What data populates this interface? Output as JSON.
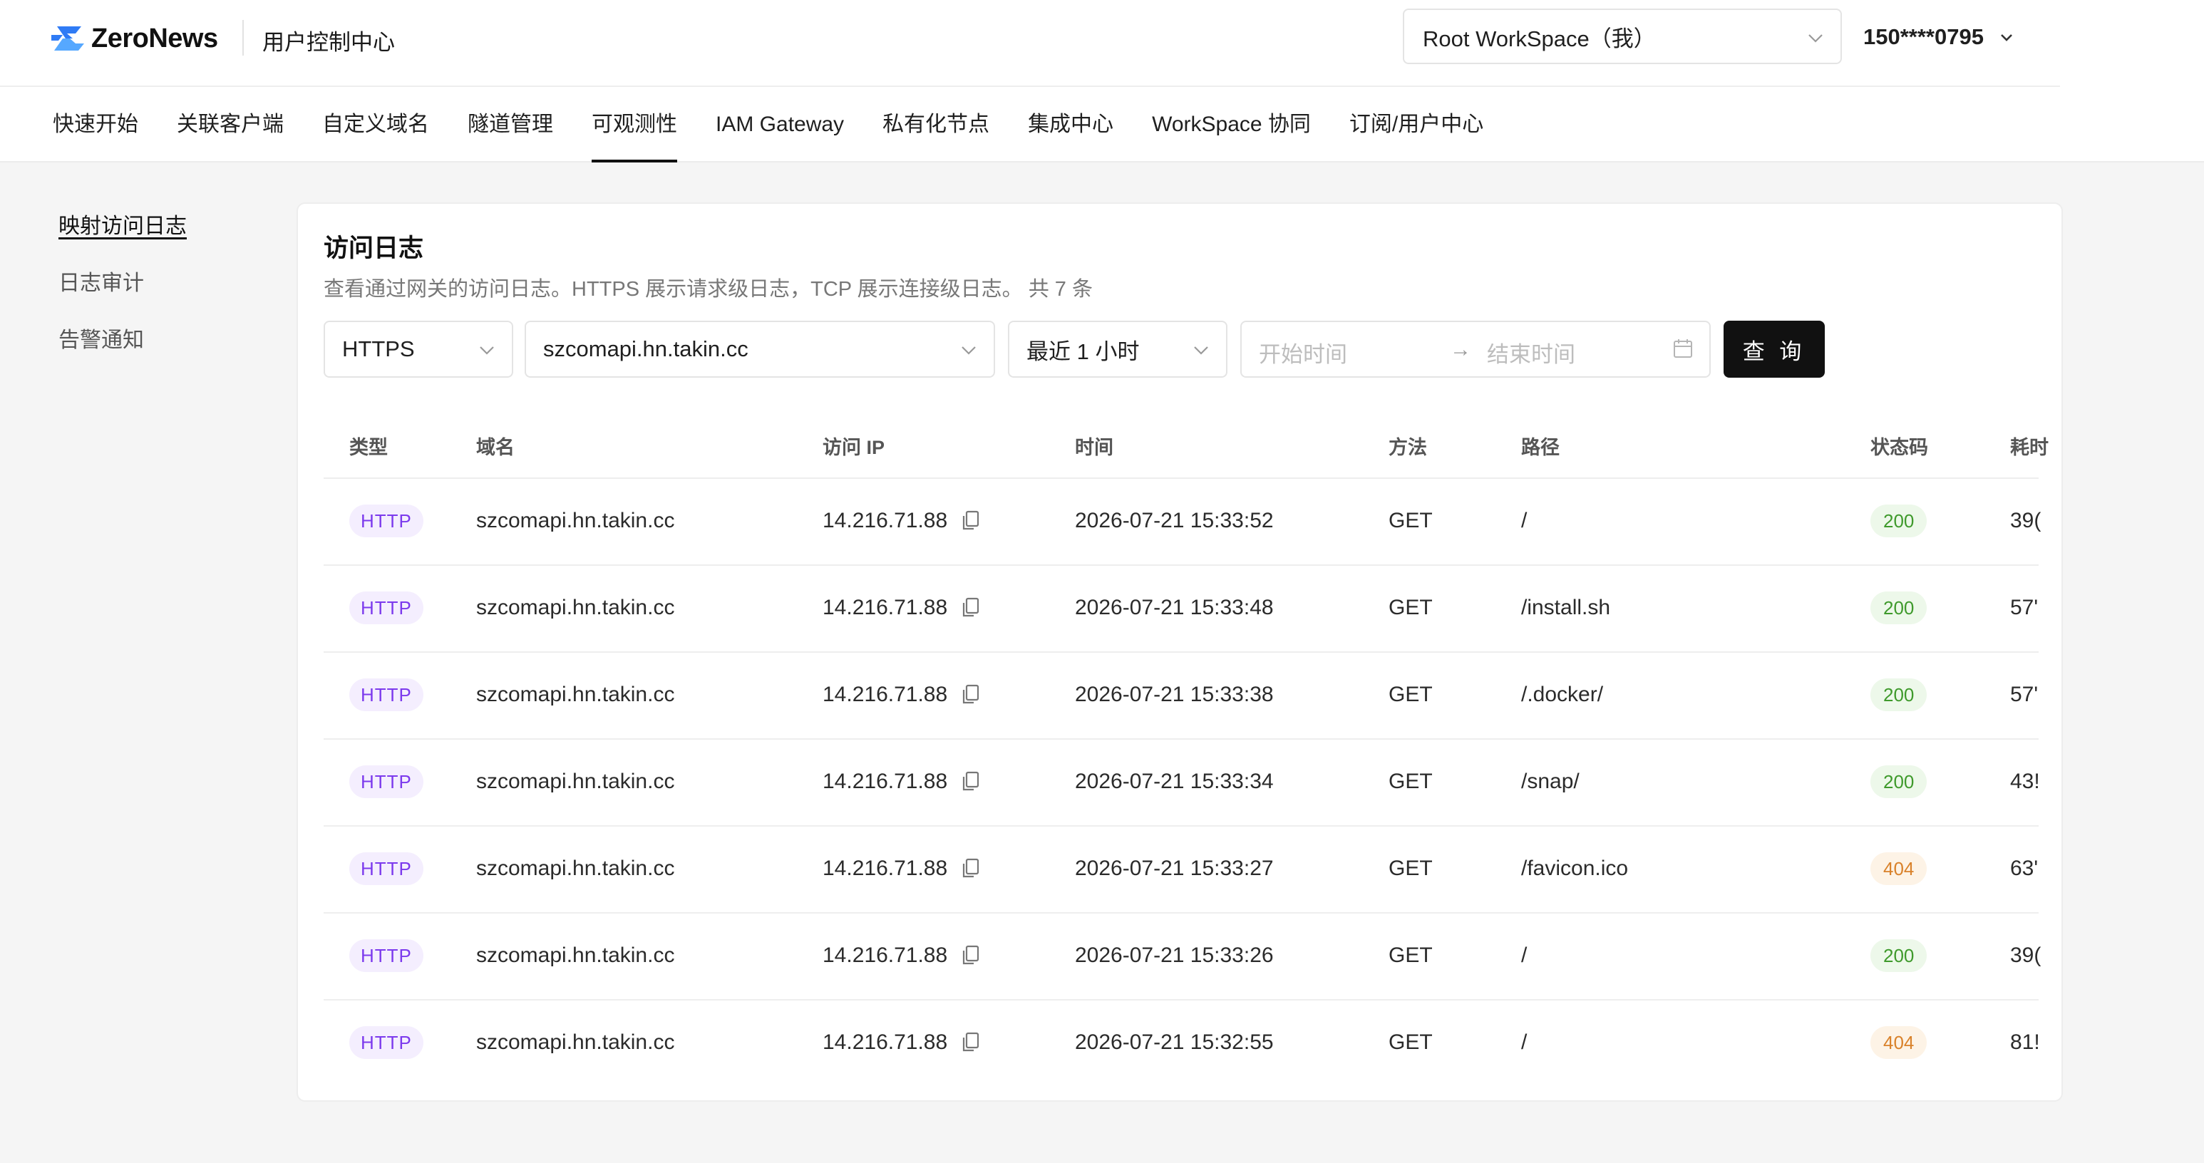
{
  "header": {
    "logo_text": "ZeroNews",
    "app_title": "用户控制中心",
    "workspace": "Root WorkSpace（我）",
    "user": "150****0795"
  },
  "nav": {
    "items": [
      "快速开始",
      "关联客户端",
      "自定义域名",
      "隧道管理",
      "可观测性",
      "IAM Gateway",
      "私有化节点",
      "集成中心",
      "WorkSpace 协同",
      "订阅/用户中心"
    ],
    "active_index": 4
  },
  "sidebar": {
    "items": [
      "映射访问日志",
      "日志审计",
      "告警通知"
    ],
    "active_index": 0
  },
  "card": {
    "title": "访问日志",
    "description": "查看通过网关的访问日志。HTTPS 展示请求级日志，TCP 展示连接级日志。 共 7 条"
  },
  "filters": {
    "protocol": "HTTPS",
    "domain": "szcomapi.hn.takin.cc",
    "range": "最近 1 小时",
    "start_placeholder": "开始时间",
    "end_placeholder": "结束时间",
    "query_label": "查 询"
  },
  "table": {
    "headers": [
      "类型",
      "域名",
      "访问 IP",
      "时间",
      "方法",
      "路径",
      "状态码",
      "耗时"
    ],
    "rows": [
      {
        "type": "HTTP",
        "domain": "szcomapi.hn.takin.cc",
        "ip": "14.216.71.88",
        "time": "2026-07-21 15:33:52",
        "method": "GET",
        "path": "/",
        "status": "200",
        "cost": "39("
      },
      {
        "type": "HTTP",
        "domain": "szcomapi.hn.takin.cc",
        "ip": "14.216.71.88",
        "time": "2026-07-21 15:33:48",
        "method": "GET",
        "path": "/install.sh",
        "status": "200",
        "cost": "57'"
      },
      {
        "type": "HTTP",
        "domain": "szcomapi.hn.takin.cc",
        "ip": "14.216.71.88",
        "time": "2026-07-21 15:33:38",
        "method": "GET",
        "path": "/.docker/",
        "status": "200",
        "cost": "57'"
      },
      {
        "type": "HTTP",
        "domain": "szcomapi.hn.takin.cc",
        "ip": "14.216.71.88",
        "time": "2026-07-21 15:33:34",
        "method": "GET",
        "path": "/snap/",
        "status": "200",
        "cost": "43!"
      },
      {
        "type": "HTTP",
        "domain": "szcomapi.hn.takin.cc",
        "ip": "14.216.71.88",
        "time": "2026-07-21 15:33:27",
        "method": "GET",
        "path": "/favicon.ico",
        "status": "404",
        "cost": "63'"
      },
      {
        "type": "HTTP",
        "domain": "szcomapi.hn.takin.cc",
        "ip": "14.216.71.88",
        "time": "2026-07-21 15:33:26",
        "method": "GET",
        "path": "/",
        "status": "200",
        "cost": "39("
      },
      {
        "type": "HTTP",
        "domain": "szcomapi.hn.takin.cc",
        "ip": "14.216.71.88",
        "time": "2026-07-21 15:32:55",
        "method": "GET",
        "path": "/",
        "status": "404",
        "cost": "81!"
      }
    ]
  },
  "colors": {
    "brand": "#3b82f6",
    "accent": "#111111",
    "tag_http": "#7c3aed",
    "status_ok": "#3f9a2c",
    "status_warn": "#d9822b"
  }
}
